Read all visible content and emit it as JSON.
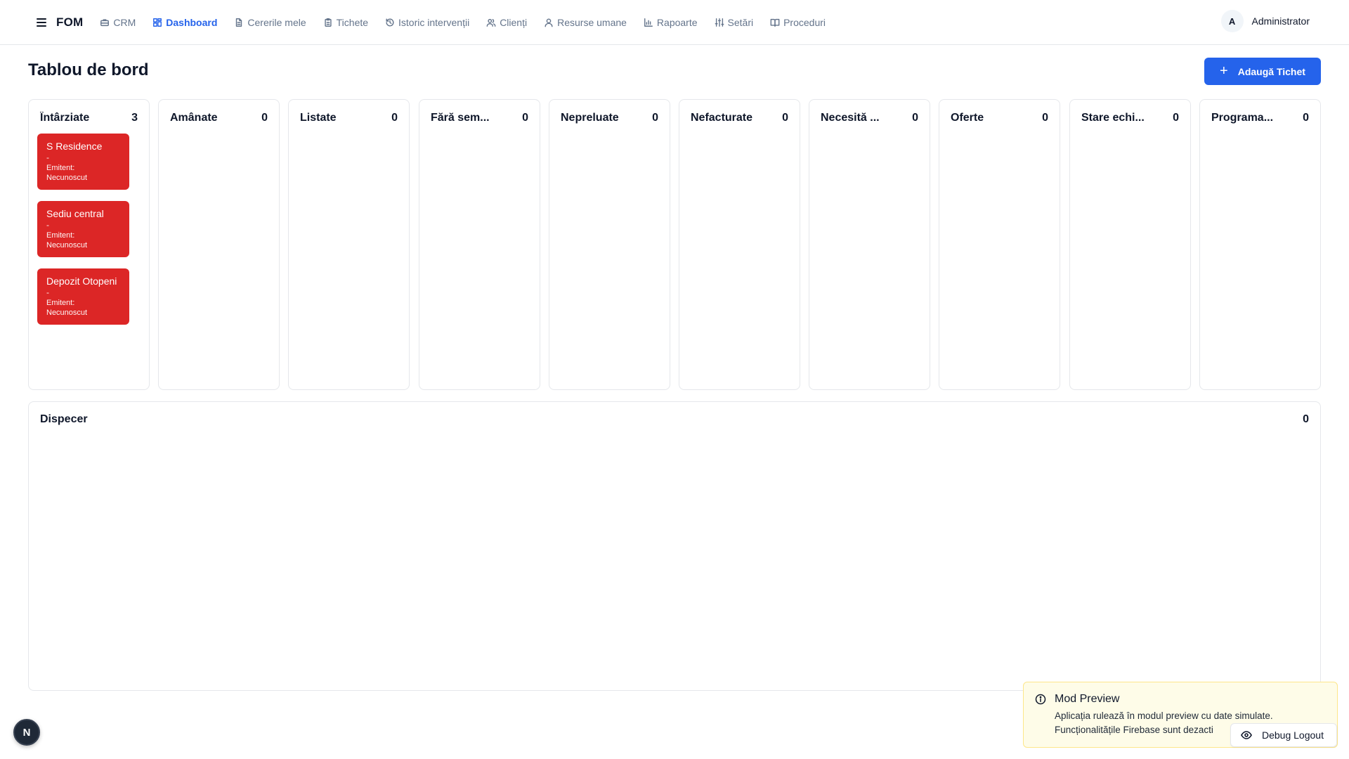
{
  "nav": {
    "brand": "FOM",
    "items": [
      {
        "label": "CRM",
        "icon": "briefcase-icon",
        "active": false
      },
      {
        "label": "Dashboard",
        "icon": "layout-grid-icon",
        "active": true
      },
      {
        "label": "Cererile mele",
        "icon": "file-text-icon",
        "active": false
      },
      {
        "label": "Tichete",
        "icon": "clipboard-icon",
        "active": false
      },
      {
        "label": "Istoric intervenții",
        "icon": "history-icon",
        "active": false
      },
      {
        "label": "Clienți",
        "icon": "users-icon",
        "active": false
      },
      {
        "label": "Resurse umane",
        "icon": "user-icon",
        "active": false
      },
      {
        "label": "Rapoarte",
        "icon": "bar-chart-icon",
        "active": false
      },
      {
        "label": "Setări",
        "icon": "sliders-icon",
        "active": false
      },
      {
        "label": "Proceduri",
        "icon": "book-open-icon",
        "active": false
      }
    ],
    "user": {
      "initial": "A",
      "name": "Administrator"
    }
  },
  "page": {
    "title": "Tablou de bord",
    "add_button": "Adaugă Tichet",
    "add_button_icon": "plus-icon"
  },
  "columns": [
    {
      "title": "Întârziate",
      "count": "3",
      "cards": [
        {
          "name": "S Residence",
          "dash": "-",
          "emitent_label": "Emitent:",
          "emitent": "Necunoscut"
        },
        {
          "name": "Sediu central",
          "dash": "-",
          "emitent_label": "Emitent:",
          "emitent": "Necunoscut"
        },
        {
          "name": "Depozit Otopeni",
          "dash": "-",
          "emitent_label": "Emitent:",
          "emitent": "Necunoscut"
        }
      ]
    },
    {
      "title": "Amânate",
      "count": "0",
      "cards": []
    },
    {
      "title": "Listate",
      "count": "0",
      "cards": []
    },
    {
      "title": "Fără sem...",
      "count": "0",
      "cards": []
    },
    {
      "title": "Nepreluate",
      "count": "0",
      "cards": []
    },
    {
      "title": "Nefacturate",
      "count": "0",
      "cards": []
    },
    {
      "title": "Necesită ...",
      "count": "0",
      "cards": []
    },
    {
      "title": "Oferte",
      "count": "0",
      "cards": []
    },
    {
      "title": "Stare echi...",
      "count": "0",
      "cards": []
    },
    {
      "title": "Programa...",
      "count": "0",
      "cards": []
    }
  ],
  "dispatcher": {
    "title": "Dispecer",
    "count": "0"
  },
  "toast": {
    "title": "Mod Preview",
    "line1": "Aplicația rulează în modul preview cu date simulate.",
    "line2": "Funcționalitățile Firebase sunt dezacti",
    "icon": "info-icon"
  },
  "debug_button": {
    "label": "Debug Logout",
    "icon": "eye-icon"
  },
  "dev_badge": {
    "label": "N"
  },
  "colors": {
    "accent": "#2563eb",
    "overdue_card": "#dc2626",
    "toast_bg": "#fefce8"
  }
}
